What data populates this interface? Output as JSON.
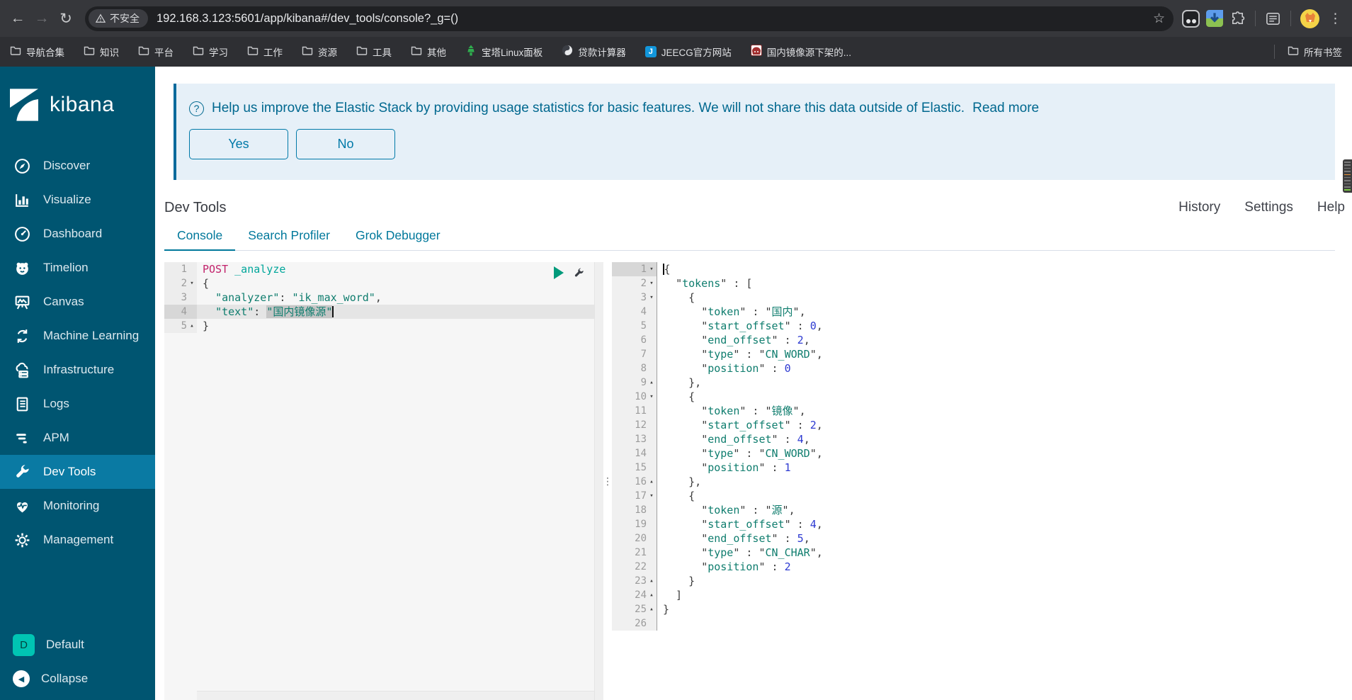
{
  "browser": {
    "url": "192.168.3.123:5601/app/kibana#/dev_tools/console?_g=()",
    "security_badge": "不安全",
    "bookmarks": [
      {
        "label": "导航合集",
        "icon": "folder"
      },
      {
        "label": "知识",
        "icon": "folder"
      },
      {
        "label": "平台",
        "icon": "folder"
      },
      {
        "label": "学习",
        "icon": "folder"
      },
      {
        "label": "工作",
        "icon": "folder"
      },
      {
        "label": "资源",
        "icon": "folder"
      },
      {
        "label": "工具",
        "icon": "folder"
      },
      {
        "label": "其他",
        "icon": "folder"
      },
      {
        "label": "宝塔Linux面板",
        "icon": "baota"
      },
      {
        "label": "贷款计算器",
        "icon": "calc"
      },
      {
        "label": "JEECG官方网站",
        "icon": "jeecg"
      },
      {
        "label": "国内镜像源下架的...",
        "icon": "mirror"
      }
    ],
    "all_bookmarks_label": "所有书签"
  },
  "sidebar": {
    "logo_text": "kibana",
    "items": [
      {
        "label": "Discover",
        "icon": "discover-icon"
      },
      {
        "label": "Visualize",
        "icon": "visualize-icon"
      },
      {
        "label": "Dashboard",
        "icon": "dashboard-icon"
      },
      {
        "label": "Timelion",
        "icon": "timelion-icon"
      },
      {
        "label": "Canvas",
        "icon": "canvas-icon"
      },
      {
        "label": "Machine Learning",
        "icon": "machine-learning-icon"
      },
      {
        "label": "Infrastructure",
        "icon": "infrastructure-icon"
      },
      {
        "label": "Logs",
        "icon": "logs-icon"
      },
      {
        "label": "APM",
        "icon": "apm-icon"
      },
      {
        "label": "Dev Tools",
        "icon": "dev-tools-icon",
        "active": true
      },
      {
        "label": "Monitoring",
        "icon": "monitoring-icon"
      },
      {
        "label": "Management",
        "icon": "management-icon"
      }
    ],
    "space": {
      "initial": "D",
      "label": "Default"
    },
    "collapse_label": "Collapse"
  },
  "banner": {
    "message": "Help us improve the Elastic Stack by providing usage statistics for basic features. We will not share this data outside of Elastic.",
    "read_more": "Read more",
    "yes_label": "Yes",
    "no_label": "No"
  },
  "devtools": {
    "title": "Dev Tools",
    "actions": [
      "History",
      "Settings",
      "Help"
    ],
    "tabs": [
      {
        "label": "Console",
        "active": true
      },
      {
        "label": "Search Profiler"
      },
      {
        "label": "Grok Debugger"
      }
    ]
  },
  "colors": {
    "sidebar": "#005571",
    "sidebar_active": "#0a7aa3",
    "accent_blue": "#00789b",
    "banner_bg": "#e6f0f8",
    "banner_text": "#00688f",
    "space_badge": "#00c4b3",
    "code_method": "#c2226b",
    "code_url": "#00a69b",
    "code_string": "#0f7d6e",
    "code_number": "#2d3ad1",
    "play_button": "#009a7b"
  },
  "request_editor": {
    "lines": [
      {
        "n": "1",
        "seg": [
          [
            "m",
            "POST"
          ],
          [
            "p",
            " "
          ],
          [
            "u",
            "_analyze"
          ]
        ]
      },
      {
        "n": "2",
        "fold": "d",
        "seg": [
          [
            "p",
            "{"
          ]
        ]
      },
      {
        "n": "3",
        "seg": [
          [
            "p",
            "  "
          ],
          [
            "k",
            "\"analyzer\""
          ],
          [
            "p",
            ": "
          ],
          [
            "s",
            "\"ik_max_word\""
          ],
          [
            "p",
            ","
          ]
        ]
      },
      {
        "n": "4",
        "active": true,
        "cursor": "end",
        "seg": [
          [
            "p",
            "  "
          ],
          [
            "k",
            "\"text\""
          ],
          [
            "p",
            ": "
          ],
          [
            "sel",
            "\"国内镜像源\""
          ]
        ]
      },
      {
        "n": "5",
        "fold": "u",
        "seg": [
          [
            "p",
            "}"
          ]
        ]
      }
    ]
  },
  "response_editor": {
    "lines": [
      {
        "n": "1",
        "fold": "d",
        "gact": true,
        "cursor": "start",
        "seg": [
          [
            "p",
            "{"
          ]
        ]
      },
      {
        "n": "2",
        "fold": "d",
        "seg": [
          [
            "p",
            "  "
          ],
          [
            "q",
            "\""
          ],
          [
            "k",
            "tokens"
          ],
          [
            "q",
            "\""
          ],
          [
            "p",
            " : ["
          ]
        ]
      },
      {
        "n": "3",
        "fold": "d",
        "seg": [
          [
            "p",
            "    {"
          ]
        ]
      },
      {
        "n": "4",
        "seg": [
          [
            "p",
            "      "
          ],
          [
            "q",
            "\""
          ],
          [
            "k",
            "token"
          ],
          [
            "q",
            "\""
          ],
          [
            "p",
            " : "
          ],
          [
            "q",
            "\""
          ],
          [
            "s",
            "国内"
          ],
          [
            "q",
            "\""
          ],
          [
            "p",
            ","
          ]
        ]
      },
      {
        "n": "5",
        "seg": [
          [
            "p",
            "      "
          ],
          [
            "q",
            "\""
          ],
          [
            "k",
            "start_offset"
          ],
          [
            "q",
            "\""
          ],
          [
            "p",
            " : "
          ],
          [
            "n",
            "0"
          ],
          [
            "p",
            ","
          ]
        ]
      },
      {
        "n": "6",
        "seg": [
          [
            "p",
            "      "
          ],
          [
            "q",
            "\""
          ],
          [
            "k",
            "end_offset"
          ],
          [
            "q",
            "\""
          ],
          [
            "p",
            " : "
          ],
          [
            "n",
            "2"
          ],
          [
            "p",
            ","
          ]
        ]
      },
      {
        "n": "7",
        "seg": [
          [
            "p",
            "      "
          ],
          [
            "q",
            "\""
          ],
          [
            "k",
            "type"
          ],
          [
            "q",
            "\""
          ],
          [
            "p",
            " : "
          ],
          [
            "q",
            "\""
          ],
          [
            "s",
            "CN_WORD"
          ],
          [
            "q",
            "\""
          ],
          [
            "p",
            ","
          ]
        ]
      },
      {
        "n": "8",
        "seg": [
          [
            "p",
            "      "
          ],
          [
            "q",
            "\""
          ],
          [
            "k",
            "position"
          ],
          [
            "q",
            "\""
          ],
          [
            "p",
            " : "
          ],
          [
            "n",
            "0"
          ]
        ]
      },
      {
        "n": "9",
        "fold": "u",
        "seg": [
          [
            "p",
            "    },"
          ]
        ]
      },
      {
        "n": "10",
        "fold": "d",
        "seg": [
          [
            "p",
            "    {"
          ]
        ]
      },
      {
        "n": "11",
        "seg": [
          [
            "p",
            "      "
          ],
          [
            "q",
            "\""
          ],
          [
            "k",
            "token"
          ],
          [
            "q",
            "\""
          ],
          [
            "p",
            " : "
          ],
          [
            "q",
            "\""
          ],
          [
            "s",
            "镜像"
          ],
          [
            "q",
            "\""
          ],
          [
            "p",
            ","
          ]
        ]
      },
      {
        "n": "12",
        "seg": [
          [
            "p",
            "      "
          ],
          [
            "q",
            "\""
          ],
          [
            "k",
            "start_offset"
          ],
          [
            "q",
            "\""
          ],
          [
            "p",
            " : "
          ],
          [
            "n",
            "2"
          ],
          [
            "p",
            ","
          ]
        ]
      },
      {
        "n": "13",
        "seg": [
          [
            "p",
            "      "
          ],
          [
            "q",
            "\""
          ],
          [
            "k",
            "end_offset"
          ],
          [
            "q",
            "\""
          ],
          [
            "p",
            " : "
          ],
          [
            "n",
            "4"
          ],
          [
            "p",
            ","
          ]
        ]
      },
      {
        "n": "14",
        "seg": [
          [
            "p",
            "      "
          ],
          [
            "q",
            "\""
          ],
          [
            "k",
            "type"
          ],
          [
            "q",
            "\""
          ],
          [
            "p",
            " : "
          ],
          [
            "q",
            "\""
          ],
          [
            "s",
            "CN_WORD"
          ],
          [
            "q",
            "\""
          ],
          [
            "p",
            ","
          ]
        ]
      },
      {
        "n": "15",
        "seg": [
          [
            "p",
            "      "
          ],
          [
            "q",
            "\""
          ],
          [
            "k",
            "position"
          ],
          [
            "q",
            "\""
          ],
          [
            "p",
            " : "
          ],
          [
            "n",
            "1"
          ]
        ]
      },
      {
        "n": "16",
        "fold": "u",
        "seg": [
          [
            "p",
            "    },"
          ]
        ]
      },
      {
        "n": "17",
        "fold": "d",
        "seg": [
          [
            "p",
            "    {"
          ]
        ]
      },
      {
        "n": "18",
        "seg": [
          [
            "p",
            "      "
          ],
          [
            "q",
            "\""
          ],
          [
            "k",
            "token"
          ],
          [
            "q",
            "\""
          ],
          [
            "p",
            " : "
          ],
          [
            "q",
            "\""
          ],
          [
            "s",
            "源"
          ],
          [
            "q",
            "\""
          ],
          [
            "p",
            ","
          ]
        ]
      },
      {
        "n": "19",
        "seg": [
          [
            "p",
            "      "
          ],
          [
            "q",
            "\""
          ],
          [
            "k",
            "start_offset"
          ],
          [
            "q",
            "\""
          ],
          [
            "p",
            " : "
          ],
          [
            "n",
            "4"
          ],
          [
            "p",
            ","
          ]
        ]
      },
      {
        "n": "20",
        "seg": [
          [
            "p",
            "      "
          ],
          [
            "q",
            "\""
          ],
          [
            "k",
            "end_offset"
          ],
          [
            "q",
            "\""
          ],
          [
            "p",
            " : "
          ],
          [
            "n",
            "5"
          ],
          [
            "p",
            ","
          ]
        ]
      },
      {
        "n": "21",
        "seg": [
          [
            "p",
            "      "
          ],
          [
            "q",
            "\""
          ],
          [
            "k",
            "type"
          ],
          [
            "q",
            "\""
          ],
          [
            "p",
            " : "
          ],
          [
            "q",
            "\""
          ],
          [
            "s",
            "CN_CHAR"
          ],
          [
            "q",
            "\""
          ],
          [
            "p",
            ","
          ]
        ]
      },
      {
        "n": "22",
        "seg": [
          [
            "p",
            "      "
          ],
          [
            "q",
            "\""
          ],
          [
            "k",
            "position"
          ],
          [
            "q",
            "\""
          ],
          [
            "p",
            " : "
          ],
          [
            "n",
            "2"
          ]
        ]
      },
      {
        "n": "23",
        "fold": "u",
        "seg": [
          [
            "p",
            "    }"
          ]
        ]
      },
      {
        "n": "24",
        "fold": "u",
        "seg": [
          [
            "p",
            "  ]"
          ]
        ]
      },
      {
        "n": "25",
        "fold": "u",
        "seg": [
          [
            "p",
            "}"
          ]
        ]
      },
      {
        "n": "26",
        "seg": []
      }
    ]
  }
}
